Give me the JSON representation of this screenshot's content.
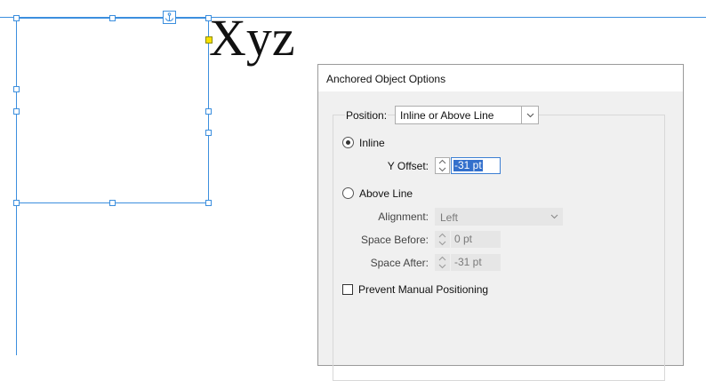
{
  "canvas": {
    "sample_text": "Xyz"
  },
  "dialog": {
    "title": "Anchored Object Options",
    "position": {
      "label": "Position:",
      "value": "Inline or Above Line"
    },
    "inline": {
      "label": "Inline",
      "checked": true,
      "y_offset": {
        "label": "Y Offset:",
        "value": "-31 pt"
      }
    },
    "above_line": {
      "label": "Above Line",
      "checked": false,
      "alignment": {
        "label": "Alignment:",
        "value": "Left"
      },
      "space_before": {
        "label": "Space Before:",
        "value": "0 pt"
      },
      "space_after": {
        "label": "Space After:",
        "value": "-31 pt"
      }
    },
    "prevent_manual_positioning": {
      "label": "Prevent Manual Positioning",
      "checked": false
    }
  },
  "colors": {
    "selection": "#3c8fde",
    "accent": "#3370cc",
    "port": "#f6e000"
  },
  "icons": {
    "anchor": "anchor-icon",
    "chevron": "chevron-down-icon",
    "stepper": "up-down-arrows-icon"
  }
}
